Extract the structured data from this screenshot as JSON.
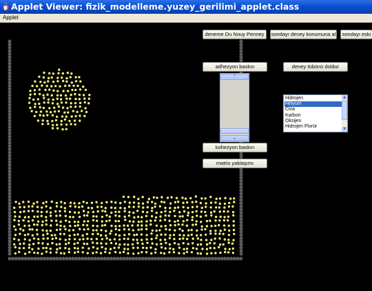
{
  "window": {
    "title": "Applet Viewer: fizik_modelleme.yuzey_gerilimi_applet.class"
  },
  "menu": {
    "items": [
      "Applet"
    ]
  },
  "buttons": {
    "du_nouy": "deneme Du Nouy Penney",
    "probe_position": "sondayı deney konumuna al",
    "probe_reset": "sondayı eski",
    "adhesion": "adhezyon baskın",
    "fill_tube": "deney tübünü doldur",
    "cohesion": "kohezyon baskın",
    "matrix": "matris yaklaşımı"
  },
  "slider": {
    "up_icon": "chevron-up-icon",
    "down_icon": "chevron-down-icon"
  },
  "substance_list": {
    "items": [
      "Hidrojen",
      "Helyum",
      "Civa",
      "Karbon",
      "Oksijen",
      "Hidrojen Florür"
    ],
    "selected": "Helyum"
  },
  "colors": {
    "particle": "#f2f07a",
    "wall_bead": "#5a5a5a",
    "background": "#000000",
    "titlebar": "#0b4fd4"
  }
}
